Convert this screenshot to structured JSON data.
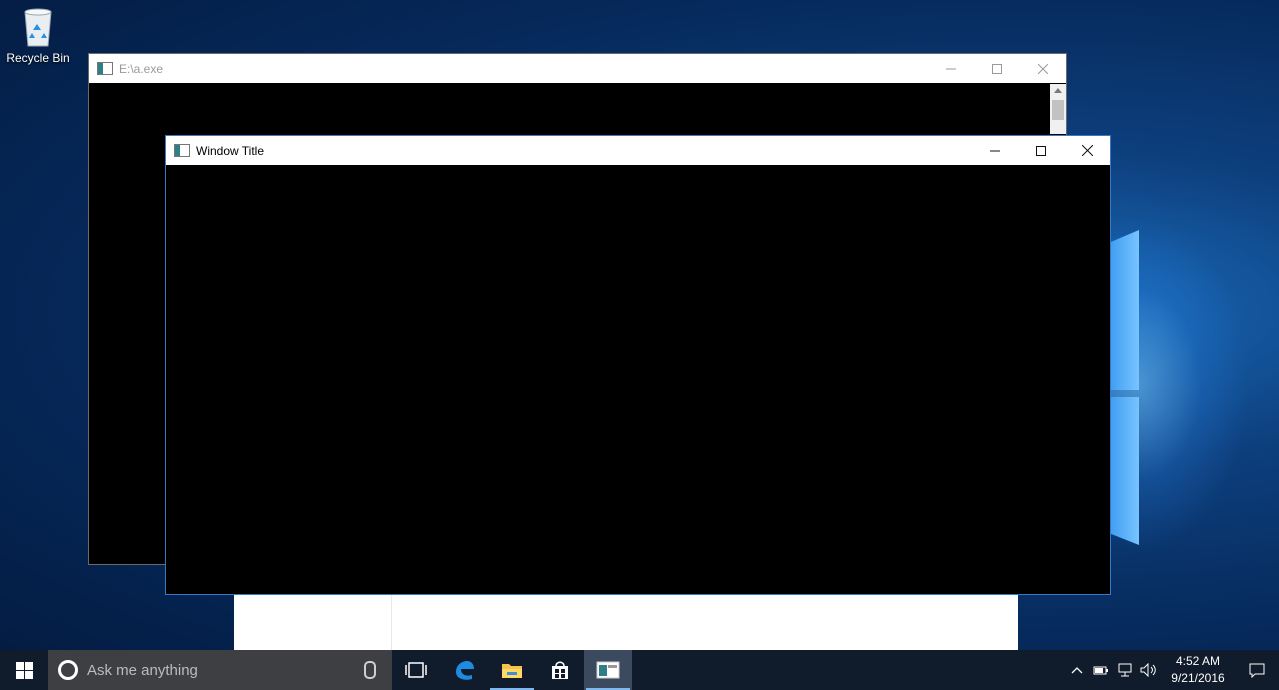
{
  "desktop": {
    "recycle_bin_label": "Recycle Bin"
  },
  "back_window": {
    "title": "E:\\a.exe"
  },
  "front_window": {
    "title": "Window Title"
  },
  "taskbar": {
    "search_placeholder": "Ask me anything",
    "pinned": [
      {
        "name": "task-view",
        "icon": "task-view-icon"
      },
      {
        "name": "edge",
        "icon": "edge-icon"
      },
      {
        "name": "file-explorer",
        "icon": "folder-icon"
      },
      {
        "name": "store",
        "icon": "store-icon"
      },
      {
        "name": "console-app",
        "icon": "app-window-icon",
        "active": true
      }
    ],
    "clock": {
      "time": "4:52 AM",
      "date": "9/21/2016"
    }
  },
  "colors": {
    "accent": "#3a78c3",
    "taskbar_bg": "#101b2b",
    "search_bg": "#3d3f42"
  }
}
